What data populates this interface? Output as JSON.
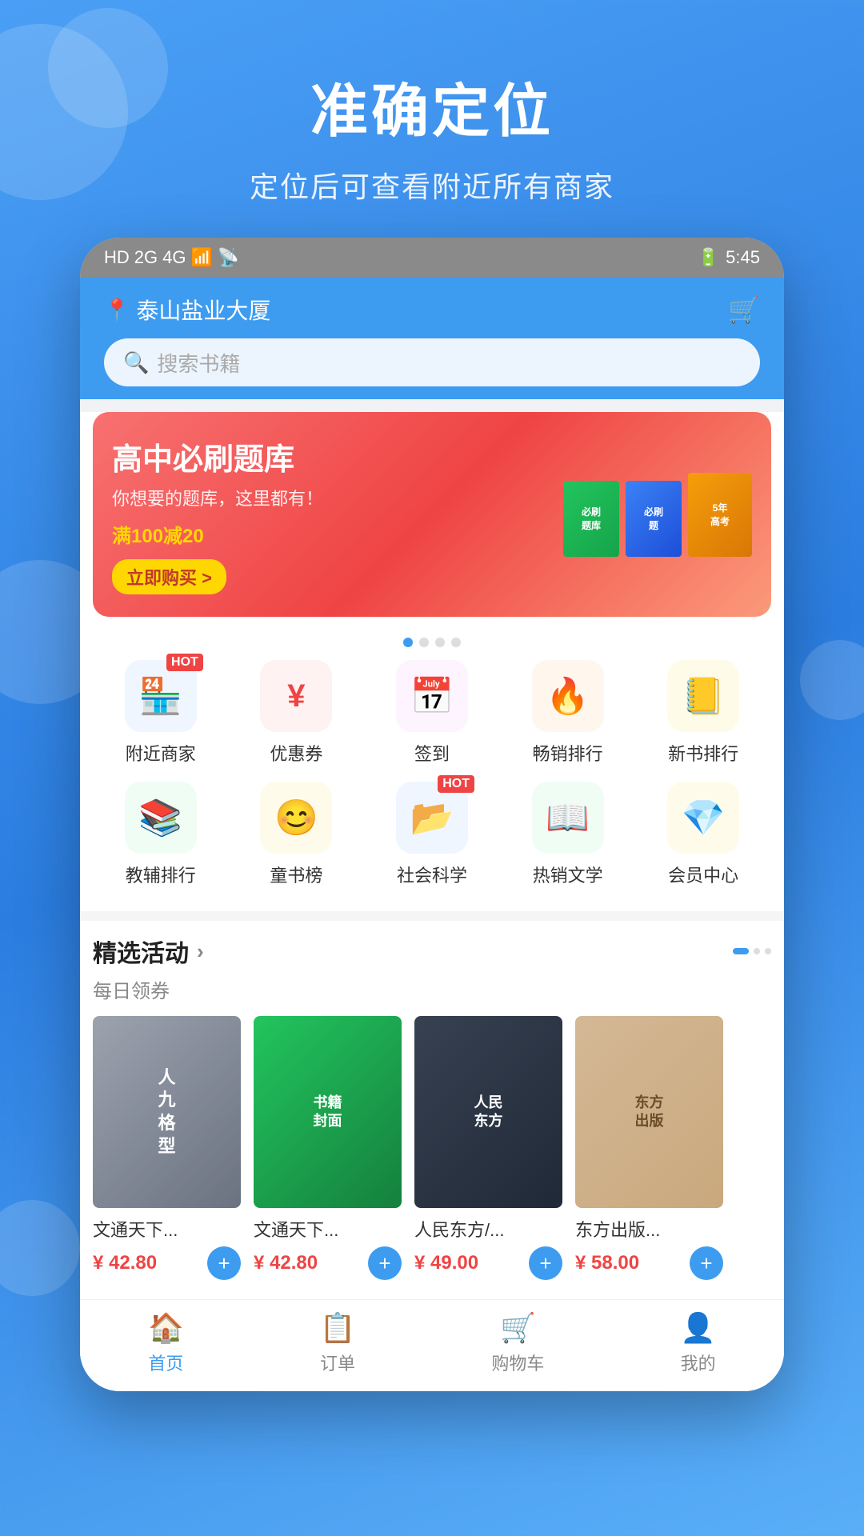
{
  "background": {
    "gradient_start": "#4a9ff5",
    "gradient_end": "#2b7de0"
  },
  "header": {
    "title": "准确定位",
    "subtitle": "定位后可查看附近所有商家"
  },
  "status_bar": {
    "left_icons": [
      "HD",
      "2G",
      "4G",
      "wifi"
    ],
    "time": "5:45",
    "battery": "■"
  },
  "app_header": {
    "location": "泰山盐业大厦",
    "search_placeholder": "搜索书籍"
  },
  "banner": {
    "title": "高中必刷题库",
    "subtitle": "你想要的题库，这里都有！",
    "discount": "满100减20",
    "button": "立即购买 >"
  },
  "banner_dots": [
    {
      "active": true
    },
    {
      "active": false
    },
    {
      "active": false
    },
    {
      "active": false
    }
  ],
  "categories_row1": [
    {
      "label": "附近商家",
      "color": "#3b82f6",
      "icon": "🏪",
      "hot": true
    },
    {
      "label": "优惠券",
      "color": "#ef4444",
      "icon": "¥",
      "hot": false
    },
    {
      "label": "签到",
      "color": "#a855f7",
      "icon": "📅",
      "hot": false
    },
    {
      "label": "畅销排行",
      "color": "#f97316",
      "icon": "🔥",
      "hot": false
    },
    {
      "label": "新书排行",
      "color": "#eab308",
      "icon": "📒",
      "hot": false
    }
  ],
  "categories_row2": [
    {
      "label": "教辅排行",
      "color": "#22c55e",
      "icon": "📚",
      "hot": false
    },
    {
      "label": "童书榜",
      "color": "#f59e0b",
      "icon": "😊",
      "hot": false
    },
    {
      "label": "社会科学",
      "color": "#3b82f6",
      "icon": "📂",
      "hot": true
    },
    {
      "label": "热销文学",
      "color": "#22c55e",
      "icon": "📖",
      "hot": false
    },
    {
      "label": "会员中心",
      "color": "#f59e0b",
      "icon": "💎",
      "hot": false
    }
  ],
  "featured": {
    "title": "精选活动",
    "arrow": "›",
    "subtitle": "每日领券"
  },
  "books": [
    {
      "name": "文通天下...",
      "price": "¥ 42.80",
      "color_class": "bc-gray"
    },
    {
      "name": "文通天下...",
      "price": "¥ 42.80",
      "color_class": "bc-green"
    },
    {
      "name": "人民东方/...",
      "price": "¥ 49.00",
      "color_class": "bc-dark"
    },
    {
      "name": "东方出版...",
      "price": "¥ 58.00",
      "color_class": "bc-beige"
    }
  ],
  "bottom_nav": [
    {
      "label": "首页",
      "icon": "🏠",
      "active": true
    },
    {
      "label": "订单",
      "icon": "📋",
      "active": false
    },
    {
      "label": "购物车",
      "icon": "🛒",
      "active": false
    },
    {
      "label": "我的",
      "icon": "👤",
      "active": false
    }
  ]
}
